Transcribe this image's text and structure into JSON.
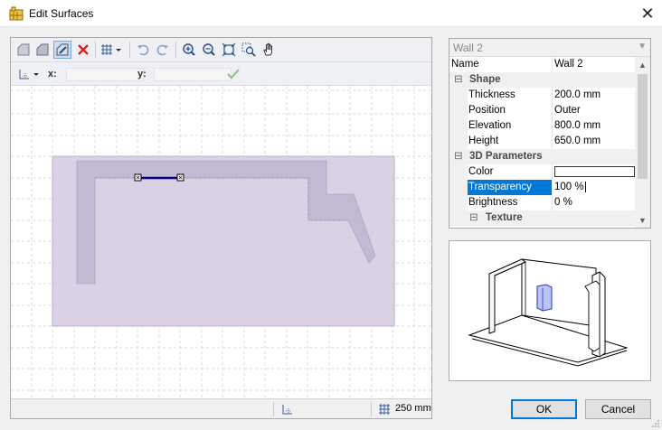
{
  "window": {
    "title": "Edit Surfaces",
    "close_glyph": "✕"
  },
  "toolbar": {
    "icons": [
      "draw-polyline-icon",
      "draw-polygon-icon",
      "edit-shape-icon",
      "delete-icon",
      "grid-icon",
      "undo-icon",
      "redo-icon",
      "zoom-in-icon",
      "zoom-out-icon",
      "zoom-extents-icon",
      "zoom-window-icon",
      "pan-hand-icon"
    ]
  },
  "coords": {
    "x_label": "x:",
    "y_label": "y:",
    "x_value": "",
    "y_value": ""
  },
  "status": {
    "grid_size": "250 mm"
  },
  "properties": {
    "object_name": "Wall 2",
    "name_label": "Name",
    "name_value": "Wall 2",
    "shape_category": "Shape",
    "thickness_label": "Thickness",
    "thickness_value": "200.0 mm",
    "position_label": "Position",
    "position_value": "Outer",
    "elevation_label": "Elevation",
    "elevation_value": "800.0 mm",
    "height_label": "Height",
    "height_value": "650.0 mm",
    "params_category": "3D Parameters",
    "color_label": "Color",
    "color_value": "#ffffff",
    "transparency_label": "Transparency",
    "transparency_value": "100 %",
    "brightness_label": "Brightness",
    "brightness_value": "0 %",
    "texture_category": "Texture",
    "collapse_glyph": "⊟"
  },
  "buttons": {
    "ok": "OK",
    "cancel": "Cancel"
  },
  "colors": {
    "surface_fill": "#d6cce2",
    "wall_fill": "#c4b9d3",
    "selection": "#000080",
    "accent": "#0078d7"
  }
}
